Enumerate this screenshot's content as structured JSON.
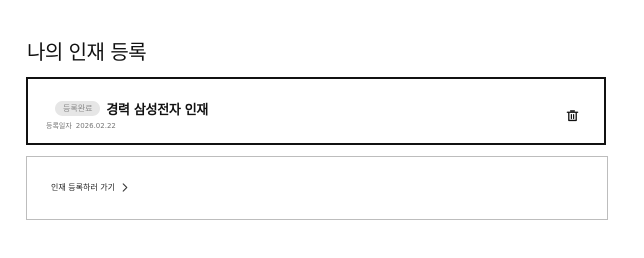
{
  "page": {
    "title": "나의 인재 등록"
  },
  "talent_card": {
    "status_badge": "등록완료",
    "title": "경력 삼성전자 인재",
    "date_label": "등록일자",
    "date_value": "2026.02.22",
    "delete_icon": "trash-icon"
  },
  "register": {
    "link_label": "인재 등록하러 가기",
    "link_icon": "chevron-right-icon"
  }
}
